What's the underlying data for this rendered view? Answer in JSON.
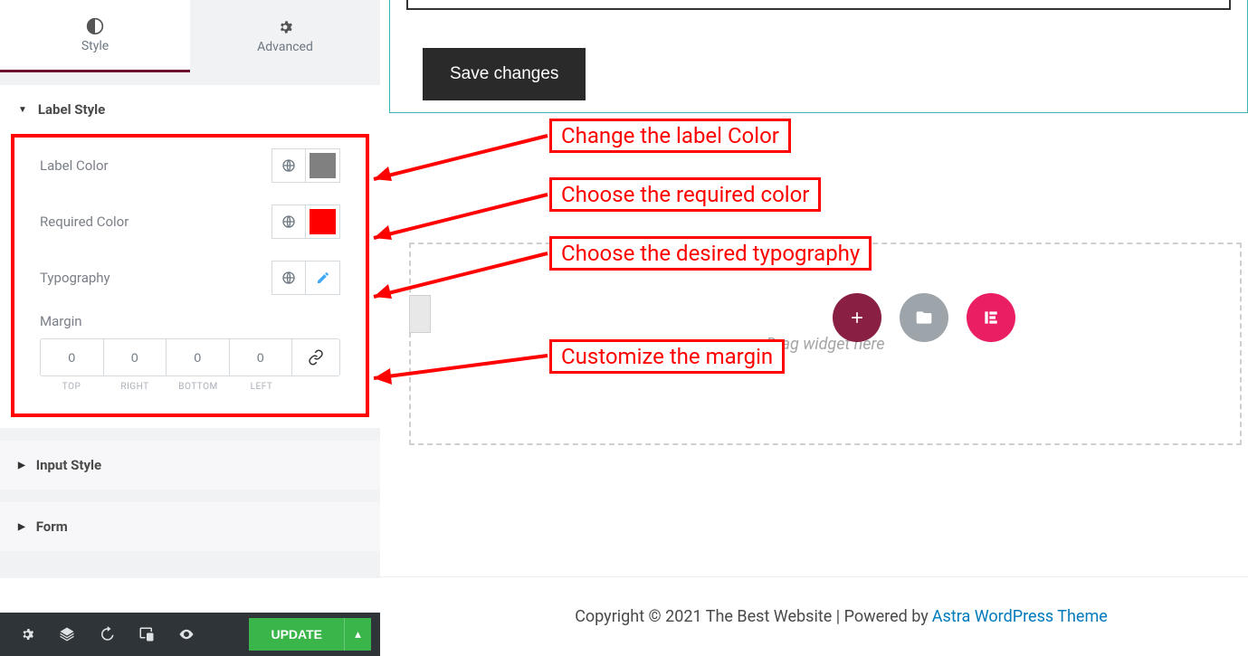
{
  "tabs": {
    "style": "Style",
    "advanced": "Advanced"
  },
  "sections": {
    "label_style": {
      "title": "Label Style",
      "open": true
    },
    "input_style": {
      "title": "Input Style",
      "open": false
    },
    "form": {
      "title": "Form",
      "open": false
    }
  },
  "controls": {
    "label_color": {
      "label": "Label Color",
      "color": "#808080"
    },
    "required_color": {
      "label": "Required Color",
      "color": "#ff0000"
    },
    "typography": {
      "label": "Typography"
    },
    "margin": {
      "label": "Margin",
      "top": "0",
      "right": "0",
      "bottom": "0",
      "left": "0",
      "cap_top": "TOP",
      "cap_right": "RIGHT",
      "cap_bottom": "BOTTOM",
      "cap_left": "LEFT"
    }
  },
  "bottom": {
    "update": "UPDATE"
  },
  "preview": {
    "save": "Save changes",
    "drag_hint": "Drag widget here"
  },
  "footer": {
    "text": "Copyright © 2021 The Best Website | Powered by",
    "link_text": "Astra WordPress Theme"
  },
  "annotations": {
    "a1": "Change the label Color",
    "a2": "Choose the required color",
    "a3": "Choose the desired typography",
    "a4": "Customize the margin"
  }
}
